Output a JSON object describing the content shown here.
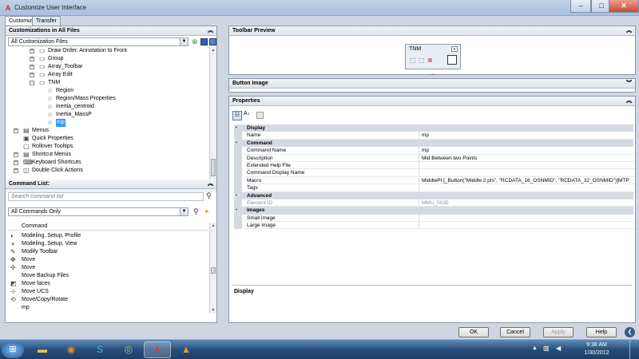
{
  "window": {
    "title": "Customize User Interface",
    "minimize": "–",
    "maximize": "□",
    "close": "✕"
  },
  "tabs": [
    {
      "label": "Customize"
    },
    {
      "label": "Transfer"
    }
  ],
  "customizations": {
    "header": "Customizations in All Files",
    "filter_value": "All Customization Files",
    "tree": [
      {
        "label": "Draw Order, Annotation to Front",
        "level": 3,
        "expander": "+",
        "icon": "toolbar-icon"
      },
      {
        "label": "Group",
        "level": 3,
        "expander": "+",
        "icon": "toolbar-icon"
      },
      {
        "label": "Array_Toolbar",
        "level": 3,
        "expander": "+",
        "icon": "toolbar-icon"
      },
      {
        "label": "Array Edit",
        "level": 3,
        "expander": "+",
        "icon": "toolbar-icon"
      },
      {
        "label": "TNM",
        "level": 3,
        "expander": "−",
        "icon": "toolbar-icon"
      },
      {
        "label": "Region",
        "level": 4,
        "expander": "",
        "icon": "star-icon"
      },
      {
        "label": "Region/Mass Properties",
        "level": 4,
        "expander": "",
        "icon": "star-icon"
      },
      {
        "label": "inertia_centroid",
        "level": 4,
        "expander": "",
        "icon": "star-icon"
      },
      {
        "label": "Inertia_MassP",
        "level": 4,
        "expander": "",
        "icon": "star-icon"
      },
      {
        "label": "mp",
        "level": 4,
        "expander": "",
        "icon": "star-icon",
        "selected": true
      },
      {
        "label": "Menus",
        "level": 1,
        "expander": "+",
        "icon": "menu-icon"
      },
      {
        "label": "Quick Properties",
        "level": 1,
        "expander": "",
        "icon": "quick-properties-icon"
      },
      {
        "label": "Rollover Tooltips",
        "level": 1,
        "expander": "",
        "icon": "tooltip-icon"
      },
      {
        "label": "Shortcut Menus",
        "level": 1,
        "expander": "+",
        "icon": "menu-icon"
      },
      {
        "label": "Keyboard Shortcuts",
        "level": 1,
        "expander": "+",
        "icon": "keyboard-icon"
      },
      {
        "label": "Double Click Actions",
        "level": 1,
        "expander": "+",
        "icon": "mouse-icon"
      }
    ]
  },
  "command_list": {
    "header": "Command List:",
    "search_placeholder": "Search command list",
    "filter_value": "All Commands Only",
    "column_header": "Command",
    "items": [
      {
        "label": "Modeling, Setup, Profile",
        "icon": "profile-icon"
      },
      {
        "label": "Modeling, Setup, View",
        "icon": "view-icon"
      },
      {
        "label": "Modify Toolbar",
        "icon": "modify-icon"
      },
      {
        "label": "Move",
        "icon": "move-icon"
      },
      {
        "label": "Move",
        "icon": "move-arrows-icon"
      },
      {
        "label": "Move Backup Files",
        "icon": ""
      },
      {
        "label": "Move faces",
        "icon": "move-faces-icon"
      },
      {
        "label": "Move UCS",
        "icon": "ucs-icon"
      },
      {
        "label": "Move/Copy/Rotate",
        "icon": "move-copy-rotate-icon"
      },
      {
        "label": "mp",
        "icon": ""
      }
    ]
  },
  "toolbar_preview": {
    "header": "Toolbar Preview",
    "toolbar_name": "TNM",
    "close_glyph": "x"
  },
  "button_image": {
    "header": "Button Image"
  },
  "properties": {
    "header": "Properties",
    "rows": [
      {
        "type": "category",
        "label": "Display"
      },
      {
        "type": "prop",
        "key": "Name",
        "value": "mp"
      },
      {
        "type": "category",
        "label": "Command"
      },
      {
        "type": "prop",
        "key": "Command Name",
        "value": "mp"
      },
      {
        "type": "prop",
        "key": "Description",
        "value": "Mid Between two Points"
      },
      {
        "type": "prop",
        "key": "Extended Help File",
        "value": ""
      },
      {
        "type": "prop",
        "key": "Command Display Name",
        "value": ""
      },
      {
        "type": "prop",
        "key": "Macro",
        "value": "MiddlePt [_Button(\"Middle 2 pts\", \"RCDATA_16_OSNMID\", \"RCDATA_32_OSNMID\")]MTP"
      },
      {
        "type": "prop",
        "key": "Tags",
        "value": ""
      },
      {
        "type": "category",
        "label": "Advanced"
      },
      {
        "type": "prop",
        "key": "Element ID",
        "value": "MMU_0035",
        "disabled": true
      },
      {
        "type": "category",
        "label": "Images"
      },
      {
        "type": "prop",
        "key": "Small image",
        "value": ""
      },
      {
        "type": "prop",
        "key": "Large image",
        "value": ""
      }
    ],
    "description_title": "Display"
  },
  "footer": {
    "ok": "OK",
    "cancel": "Cancel",
    "apply": "Apply",
    "help": "Help",
    "less_glyph": "❮"
  },
  "taskbar": {
    "time": "9:38 AM",
    "date": "1/30/2012"
  },
  "colors": {
    "selection": "#3399ff",
    "taskbar": "#274f7d"
  }
}
